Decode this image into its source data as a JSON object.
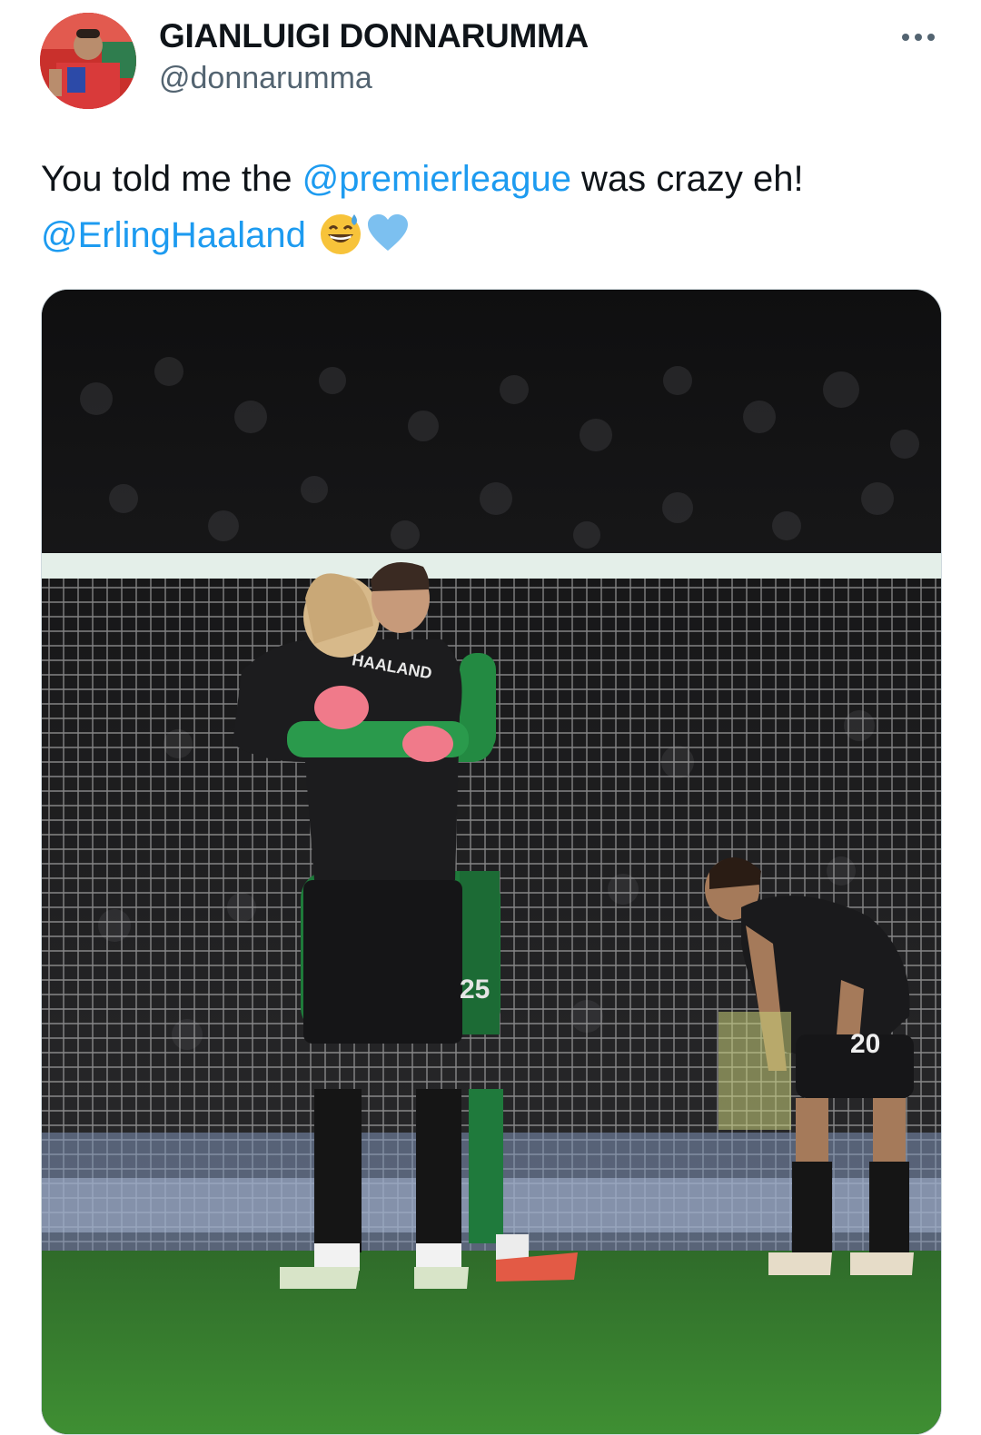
{
  "tweet": {
    "author": {
      "display_name": "GIANLUIGI DONNARUMMA",
      "handle": "@donnarumma",
      "avatar_icon": "profile-photo-goalkeeper"
    },
    "more_icon": "ellipsis-icon",
    "text": {
      "part1": "You told me the ",
      "mention1": "@premierleague",
      "part2": " was crazy eh!",
      "mention2": "@ErlingHaaland",
      "emojis": [
        "grinning-face-with-sweat-emoji",
        "light-blue-heart-emoji"
      ]
    },
    "media": {
      "type": "photo",
      "subject": "two players embracing in front of goal net, third player bent over",
      "jersey_lettering": [
        "HAALAND",
        "25",
        "20"
      ]
    }
  },
  "colors": {
    "text_primary": "#0f1419",
    "text_secondary": "#536471",
    "mention": "#1d9bf0",
    "heart": "#7cc0f0"
  }
}
